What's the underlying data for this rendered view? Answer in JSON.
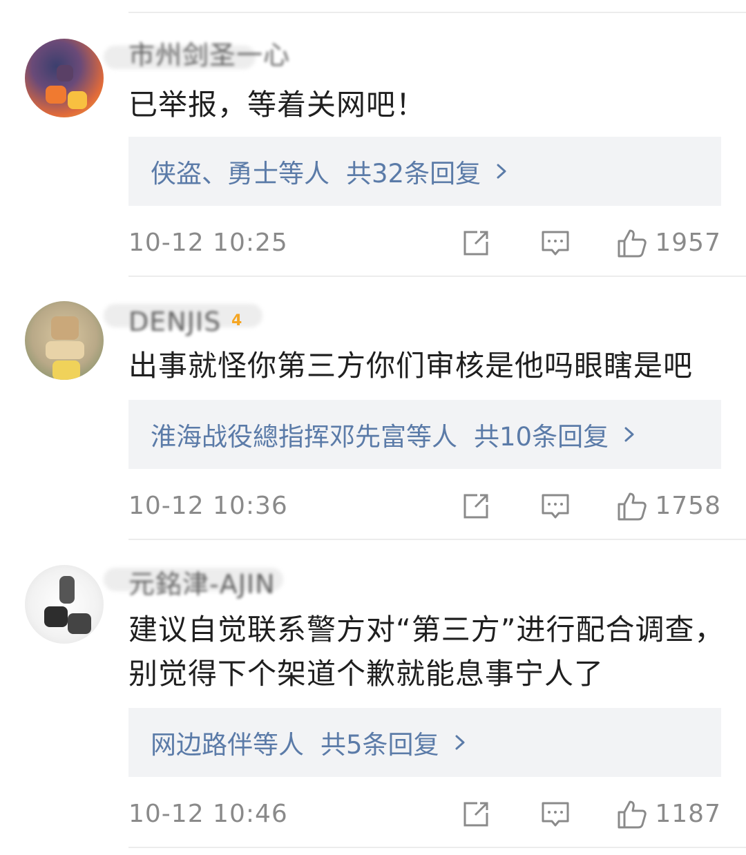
{
  "comments": [
    {
      "username": "市州剑圣一心",
      "badge": "",
      "text": "已举报，等着关网吧！",
      "reply_names": "侠盗、勇士",
      "reply_etal": "等人",
      "reply_total": "共32条回复",
      "time": "10-12 10:25",
      "likes": "1957"
    },
    {
      "username": "DENJIS",
      "badge": "4",
      "text": "出事就怪你第三方你们审核是他吗眼瞎是吧",
      "reply_names": "淮海战役總指挥邓先富",
      "reply_etal": "等人",
      "reply_total": "共10条回复",
      "time": "10-12 10:36",
      "likes": "1758"
    },
    {
      "username": "元銘津-AJIN",
      "badge": "",
      "text": "建议自觉联系警方对“第三方”进行配合调查，别觉得下个架道个歉就能息事宁人了",
      "reply_names": "网边路伴",
      "reply_etal": "等人",
      "reply_total": "共5条回复",
      "time": "10-12 10:46",
      "likes": "1187"
    }
  ],
  "icons": {
    "share": "share-icon",
    "comment": "comment-icon",
    "like": "thumbs-up-icon",
    "chevron": "chevron-right-icon"
  },
  "colors": {
    "link": "#5b7ba8",
    "reply_bg": "#f2f3f5",
    "meta": "#8a8a8a",
    "text": "#1f1f1f",
    "badge": "#f5a623"
  }
}
